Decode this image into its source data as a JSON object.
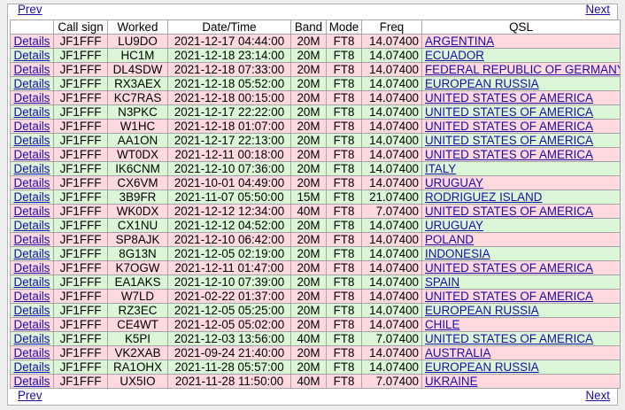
{
  "nav": {
    "prev": "Prev",
    "next": "Next"
  },
  "columns": [
    "",
    "Call sign",
    "Worked",
    "Date/Time",
    "Band",
    "Mode",
    "Freq",
    "QSL"
  ],
  "colors": {
    "pink_row": "#ffd9de",
    "green_row": "#dcf7d8",
    "link": "#1a0dab"
  },
  "rows": [
    {
      "details": "Details",
      "call": "JF1FFF",
      "worked": "LU9DO",
      "datetime": "2021-12-17 04:44:00",
      "band": "20M",
      "mode": "FT8",
      "freq": "14.07400",
      "qsl": "ARGENTINA",
      "row_style": "pink"
    },
    {
      "details": "Details",
      "call": "JF1FFF",
      "worked": "HC1M",
      "datetime": "2021-12-18 23:14:00",
      "band": "20M",
      "mode": "FT8",
      "freq": "14.07400",
      "qsl": "ECUADOR",
      "row_style": "green"
    },
    {
      "details": "Details",
      "call": "JF1FFF",
      "worked": "DL4SDW",
      "datetime": "2021-12-18 07:33:00",
      "band": "20M",
      "mode": "FT8",
      "freq": "14.07400",
      "qsl": "FEDERAL REPUBLIC OF GERMANY",
      "row_style": "pink"
    },
    {
      "details": "Details",
      "call": "JF1FFF",
      "worked": "RX3AEX",
      "datetime": "2021-12-18 05:52:00",
      "band": "20M",
      "mode": "FT8",
      "freq": "14.07400",
      "qsl": "EUROPEAN RUSSIA",
      "row_style": "green"
    },
    {
      "details": "Details",
      "call": "JF1FFF",
      "worked": "KC7RAS",
      "datetime": "2021-12-18 00:15:00",
      "band": "20M",
      "mode": "FT8",
      "freq": "14.07400",
      "qsl": "UNITED STATES OF AMERICA",
      "row_style": "pink"
    },
    {
      "details": "Details",
      "call": "JF1FFF",
      "worked": "N3PKC",
      "datetime": "2021-12-17 22:22:00",
      "band": "20M",
      "mode": "FT8",
      "freq": "14.07400",
      "qsl": "UNITED STATES OF AMERICA",
      "row_style": "green"
    },
    {
      "details": "Details",
      "call": "JF1FFF",
      "worked": "W1HC",
      "datetime": "2021-12-18 01:07:00",
      "band": "20M",
      "mode": "FT8",
      "freq": "14.07400",
      "qsl": "UNITED STATES OF AMERICA",
      "row_style": "pink"
    },
    {
      "details": "Details",
      "call": "JF1FFF",
      "worked": "AA1ON",
      "datetime": "2021-12-17 22:13:00",
      "band": "20M",
      "mode": "FT8",
      "freq": "14.07400",
      "qsl": "UNITED STATES OF AMERICA",
      "row_style": "green"
    },
    {
      "details": "Details",
      "call": "JF1FFF",
      "worked": "WT0DX",
      "datetime": "2021-12-11 00:18:00",
      "band": "20M",
      "mode": "FT8",
      "freq": "14.07400",
      "qsl": "UNITED STATES OF AMERICA",
      "row_style": "pink"
    },
    {
      "details": "Details",
      "call": "JF1FFF",
      "worked": "IK6CNM",
      "datetime": "2021-12-10 07:36:00",
      "band": "20M",
      "mode": "FT8",
      "freq": "14.07400",
      "qsl": "ITALY",
      "row_style": "green"
    },
    {
      "details": "Details",
      "call": "JF1FFF",
      "worked": "CX6VM",
      "datetime": "2021-10-01 04:49:00",
      "band": "20M",
      "mode": "FT8",
      "freq": "14.07400",
      "qsl": "URUGUAY",
      "row_style": "pink"
    },
    {
      "details": "Details",
      "call": "JF1FFF",
      "worked": "3B9FR",
      "datetime": "2021-11-07 05:50:00",
      "band": "15M",
      "mode": "FT8",
      "freq": "21.07400",
      "qsl": "RODRIGUEZ ISLAND",
      "row_style": "green"
    },
    {
      "details": "Details",
      "call": "JF1FFF",
      "worked": "WK0DX",
      "datetime": "2021-12-12 12:34:00",
      "band": "40M",
      "mode": "FT8",
      "freq": "7.07400",
      "qsl": "UNITED STATES OF AMERICA",
      "row_style": "pink"
    },
    {
      "details": "Details",
      "call": "JF1FFF",
      "worked": "CX1NU",
      "datetime": "2021-12-12 04:52:00",
      "band": "20M",
      "mode": "FT8",
      "freq": "14.07400",
      "qsl": "URUGUAY",
      "row_style": "green"
    },
    {
      "details": "Details",
      "call": "JF1FFF",
      "worked": "SP8AJK",
      "datetime": "2021-12-10 06:42:00",
      "band": "20M",
      "mode": "FT8",
      "freq": "14.07400",
      "qsl": "POLAND",
      "row_style": "pink"
    },
    {
      "details": "Details",
      "call": "JF1FFF",
      "worked": "8G13N",
      "datetime": "2021-12-05 02:19:00",
      "band": "20M",
      "mode": "FT8",
      "freq": "14.07400",
      "qsl": "INDONESIA",
      "row_style": "green"
    },
    {
      "details": "Details",
      "call": "JF1FFF",
      "worked": "K7OGW",
      "datetime": "2021-12-11 01:47:00",
      "band": "20M",
      "mode": "FT8",
      "freq": "14.07400",
      "qsl": "UNITED STATES OF AMERICA",
      "row_style": "pink"
    },
    {
      "details": "Details",
      "call": "JF1FFF",
      "worked": "EA1AKS",
      "datetime": "2021-12-10 07:39:00",
      "band": "20M",
      "mode": "FT8",
      "freq": "14.07400",
      "qsl": "SPAIN",
      "row_style": "green"
    },
    {
      "details": "Details",
      "call": "JF1FFF",
      "worked": "W7LD",
      "datetime": "2021-02-22 01:37:00",
      "band": "20M",
      "mode": "FT8",
      "freq": "14.07400",
      "qsl": "UNITED STATES OF AMERICA",
      "row_style": "pink"
    },
    {
      "details": "Details",
      "call": "JF1FFF",
      "worked": "RZ3EC",
      "datetime": "2021-12-05 05:25:00",
      "band": "20M",
      "mode": "FT8",
      "freq": "14.07400",
      "qsl": "EUROPEAN RUSSIA",
      "row_style": "green"
    },
    {
      "details": "Details",
      "call": "JF1FFF",
      "worked": "CE4WT",
      "datetime": "2021-12-05 05:02:00",
      "band": "20M",
      "mode": "FT8",
      "freq": "14.07400",
      "qsl": "CHILE",
      "row_style": "pink"
    },
    {
      "details": "Details",
      "call": "JF1FFF",
      "worked": "K5PI",
      "datetime": "2021-12-03 13:56:00",
      "band": "40M",
      "mode": "FT8",
      "freq": "7.07400",
      "qsl": "UNITED STATES OF AMERICA",
      "row_style": "green"
    },
    {
      "details": "Details",
      "call": "JF1FFF",
      "worked": "VK2XAB",
      "datetime": "2021-09-24 21:40:00",
      "band": "20M",
      "mode": "FT8",
      "freq": "14.07400",
      "qsl": "AUSTRALIA",
      "row_style": "pink"
    },
    {
      "details": "Details",
      "call": "JF1FFF",
      "worked": "RA1OHX",
      "datetime": "2021-11-28 05:57:00",
      "band": "20M",
      "mode": "FT8",
      "freq": "14.07400",
      "qsl": "EUROPEAN RUSSIA",
      "row_style": "green"
    },
    {
      "details": "Details",
      "call": "JF1FFF",
      "worked": "UX5IO",
      "datetime": "2021-11-28 11:50:00",
      "band": "40M",
      "mode": "FT8",
      "freq": "7.07400",
      "qsl": "UKRAINE",
      "row_style": "pink"
    }
  ]
}
